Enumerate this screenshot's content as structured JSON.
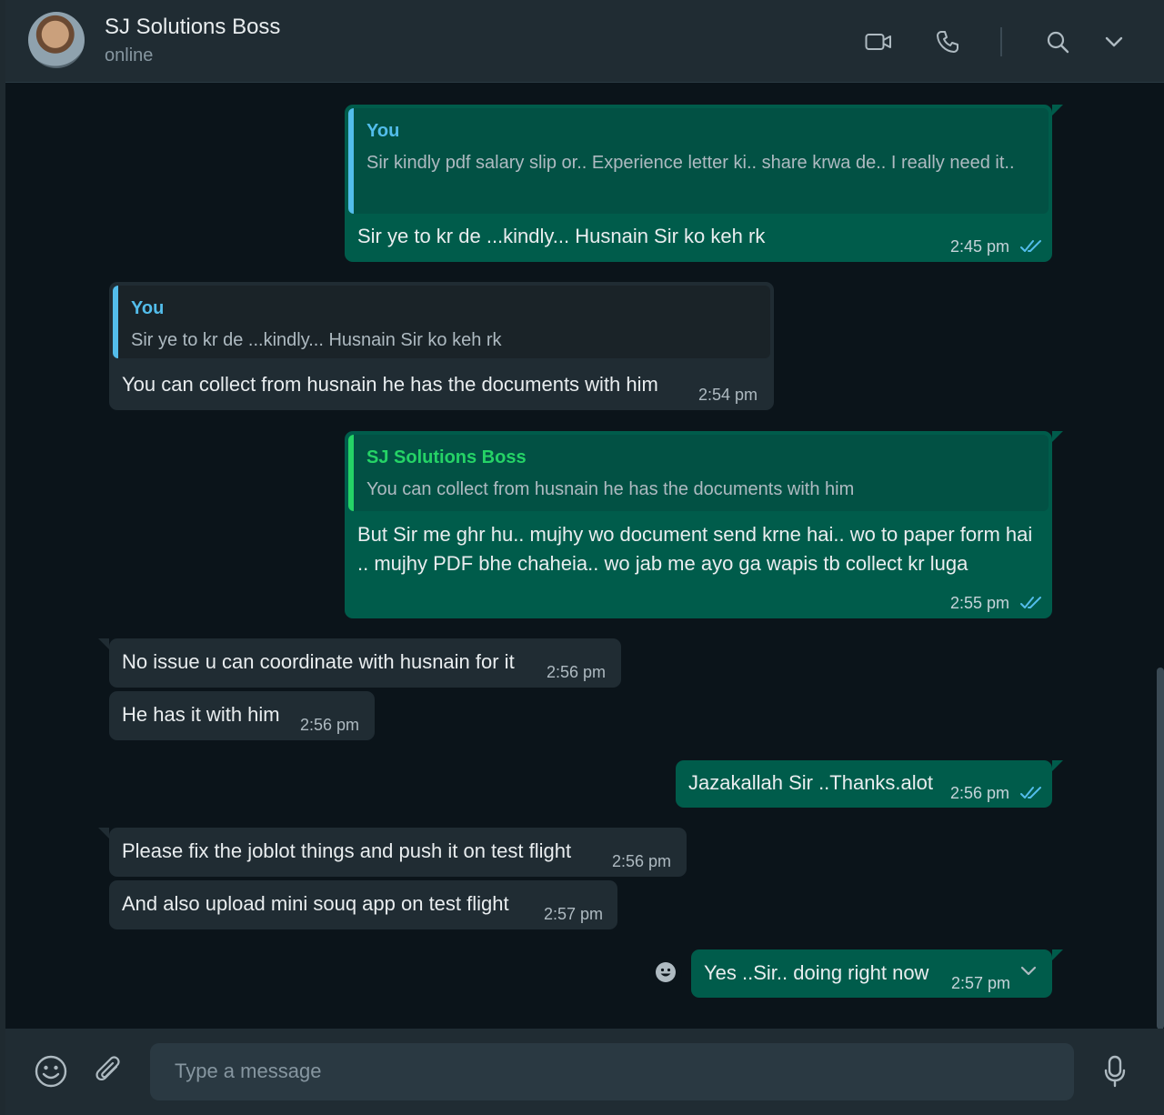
{
  "header": {
    "contact_name": "SJ Solutions Boss",
    "status": "online",
    "icons": [
      "video-call-icon",
      "voice-call-icon",
      "search-icon",
      "chevron-down-icon"
    ]
  },
  "colors": {
    "outgoing_bubble": "#005c4b",
    "incoming_bubble": "#202c33",
    "quote_you_in": "#53bdeb",
    "quote_boss": "#25d366",
    "read_ticks": "#53bdeb"
  },
  "messages": [
    {
      "direction": "out",
      "quote": {
        "author": "You",
        "text": "Sir kindly pdf salary slip or.. Experience letter ki.. share krwa de.. I really need it.."
      },
      "text": "Sir ye to kr de ...kindly... Husnain Sir ko keh rk",
      "time": "2:45 pm",
      "status": "read"
    },
    {
      "direction": "in",
      "quote": {
        "author": "You",
        "text": "Sir ye to kr de ...kindly... Husnain Sir ko keh rk"
      },
      "text": "You can collect from husnain he has the documents with him",
      "time": "2:54 pm"
    },
    {
      "direction": "out",
      "quote": {
        "author": "SJ Solutions Boss",
        "text": "You can collect from husnain he has the documents with him"
      },
      "text": "But Sir me ghr hu.. mujhy wo document send krne hai.. wo to paper form hai .. mujhy PDF bhe chaheia.. wo jab me ayo ga wapis tb collect kr luga",
      "time": "2:55 pm",
      "status": "read"
    },
    {
      "direction": "in",
      "text": "No issue u can coordinate with husnain for it",
      "time": "2:56 pm"
    },
    {
      "direction": "in",
      "text": "He has it with him",
      "time": "2:56 pm"
    },
    {
      "direction": "out",
      "text": "Jazakallah Sir ..Thanks.alot",
      "time": "2:56 pm",
      "status": "read"
    },
    {
      "direction": "in",
      "text": "Please fix the joblot things and push it on test flight",
      "time": "2:56 pm"
    },
    {
      "direction": "in",
      "text": "And also upload mini souq app on test flight",
      "time": "2:57 pm"
    },
    {
      "direction": "out",
      "text": "Yes ..Sir.. doing right now",
      "time": "2:57 pm"
    }
  ],
  "composer": {
    "placeholder": "Type a message",
    "icons": [
      "emoji-icon",
      "attach-icon",
      "microphone-icon"
    ]
  }
}
